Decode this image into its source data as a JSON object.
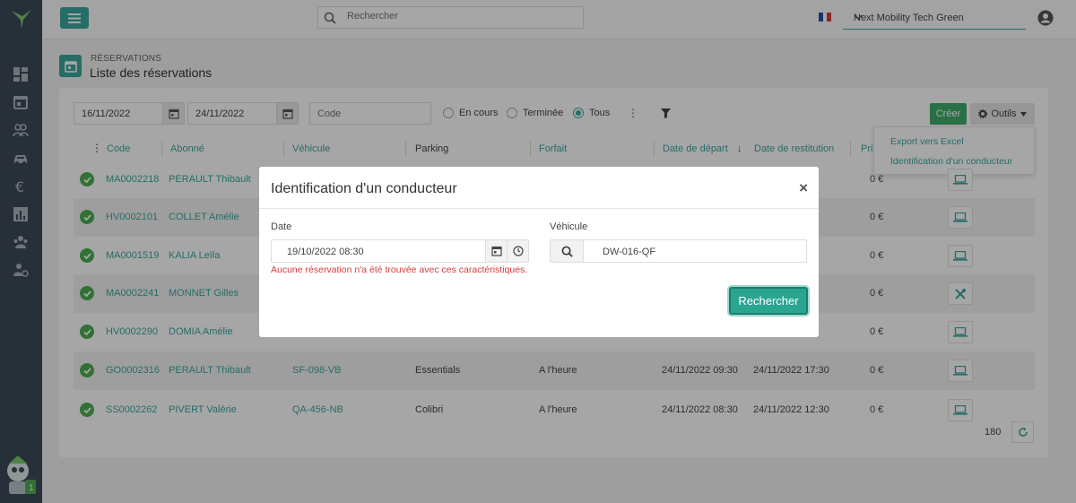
{
  "topbar": {
    "search_placeholder": "Rechercher",
    "organization": "Next Mobility Tech Green"
  },
  "page": {
    "kicker": "RÉSERVATIONS",
    "title": "Liste des réservations"
  },
  "filters": {
    "date_from": "16/11/2022",
    "date_to": "24/11/2022",
    "code_placeholder": "Code",
    "status_options": [
      "En cours",
      "Terminée",
      "Tous"
    ],
    "status_selected": "Tous"
  },
  "actions": {
    "create_label": "Créer",
    "tools_label": "Outils",
    "tools_menu": [
      "Export vers Excel",
      "Identification d'un conducteur"
    ]
  },
  "table": {
    "columns": [
      "Code",
      "Abonné",
      "Véhicule",
      "Parking",
      "Forfait",
      "Date de départ",
      "Date de restitution",
      "Pri"
    ],
    "rows": [
      {
        "code": "MA0002218",
        "abonne": "PERAULT Thibault",
        "vehicule": "",
        "parking": "",
        "forfait": "",
        "depart": "",
        "restitution": "",
        "prix": "0 €",
        "device": "laptop"
      },
      {
        "code": "HV0002101",
        "abonne": "COLLET Amélie",
        "vehicule": "",
        "parking": "",
        "forfait": "",
        "depart": "",
        "restitution": "",
        "prix": "0 €",
        "device": "laptop"
      },
      {
        "code": "MA0001519",
        "abonne": "KALIA Leïla",
        "vehicule": "",
        "parking": "",
        "forfait": "",
        "depart": "",
        "restitution": "",
        "prix": "0 €",
        "device": "laptop"
      },
      {
        "code": "MA0002241",
        "abonne": "MONNET Gilles",
        "vehicule": "",
        "parking": "",
        "forfait": "",
        "depart": "",
        "restitution": "",
        "prix": "0 €",
        "device": "tools"
      },
      {
        "code": "HV0002290",
        "abonne": "DOMIA Amélie",
        "vehicule": "",
        "parking": "",
        "forfait": "",
        "depart": "",
        "restitution": "",
        "prix": "0 €",
        "device": "laptop"
      },
      {
        "code": "GO0002316",
        "abonne": "PERAULT Thibault",
        "vehicule": "SF-098-VB",
        "parking": "Essentials",
        "forfait": "A l'heure",
        "depart": "24/11/2022 09:30",
        "restitution": "24/11/2022 17:30",
        "prix": "0 €",
        "device": "laptop"
      },
      {
        "code": "SS0002262",
        "abonne": "PIVERT Valérie",
        "vehicule": "QA-456-NB",
        "parking": "Colibri",
        "forfait": "A l'heure",
        "depart": "24/11/2022 08:30",
        "restitution": "24/11/2022 12:30",
        "prix": "0 €",
        "device": "laptop"
      }
    ],
    "total": "180"
  },
  "modal": {
    "title": "Identification d'un conducteur",
    "date_label": "Date",
    "date_value": "19/10/2022 08:30",
    "error": "Aucune réservation n'a été trouvée avec ces caractéristiques.",
    "vehicle_label": "Véhicule",
    "vehicle_value": "DW-016-QF",
    "search_button": "Rechercher"
  },
  "colors": {
    "accent": "#3aa89d",
    "sidebar": "#3d4a56",
    "success": "#4caf50",
    "create": "#40ac6c",
    "error": "#d93a3a"
  }
}
